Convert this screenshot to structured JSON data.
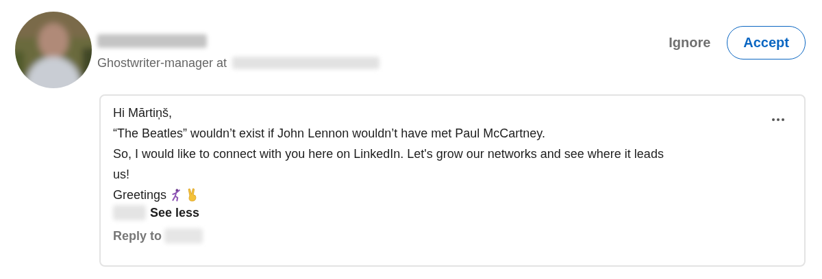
{
  "sender": {
    "headline_prefix": "Ghostwriter-manager at"
  },
  "actions": [
    {
      "label": "Ignore",
      "kind": "text"
    },
    {
      "label": "Accept",
      "kind": "outlined"
    }
  ],
  "message": {
    "lines": [
      "Hi Mārtiņš,",
      "“The Beatles” wouldn’t exist if John Lennon wouldn’t have met Paul McCartney.",
      "So, I would like to connect with you here on LinkedIn. Let's grow our networks and see where it leads us!"
    ],
    "closing": "Greetings",
    "toggle": "See less",
    "reply_prefix": "Reply to"
  }
}
